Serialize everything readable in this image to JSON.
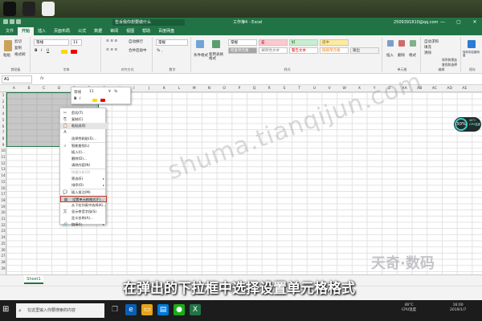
{
  "window": {
    "title": "工作簿4 - Excel",
    "search_placeholder": "告诉我你想要做什么",
    "user": "2509391810@qq.com",
    "controls": [
      "—",
      "▢",
      "✕"
    ]
  },
  "tabs": [
    "文件",
    "开始",
    "插入",
    "页面布局",
    "公式",
    "数据",
    "审阅",
    "视图",
    "帮助",
    "百度网盘"
  ],
  "active_tab": "开始",
  "ribbon": {
    "clipboard": {
      "label": "剪贴板",
      "cut": "剪切",
      "copy": "复制",
      "format_painter": "格式刷",
      "paste": "粘贴"
    },
    "font": {
      "label": "字体",
      "name": "等线",
      "size": "11"
    },
    "alignment": {
      "label": "对齐方式",
      "wrap": "自动换行",
      "merge": "合并后居中"
    },
    "number": {
      "label": "数字",
      "format": "常规"
    },
    "styles": {
      "label": "样式",
      "cond_format": "条件格式",
      "table_format": "套用表格格式",
      "items": [
        "常规",
        "差",
        "好",
        "适中",
        "检查单元格",
        "解释性文本",
        "警告文本",
        "链接单元格",
        "输出"
      ]
    },
    "cells": {
      "label": "单元格",
      "insert": "插入",
      "delete": "删除",
      "format": "格式"
    },
    "editing": {
      "label": "编辑",
      "autosum": "自动求和",
      "fill": "填充",
      "clear": "清除",
      "sort": "排序和筛选",
      "find": "查找和选择"
    },
    "save": {
      "label": "保存",
      "button": "保存到百度网盘"
    }
  },
  "formula_bar": {
    "name_box": "A1",
    "fx": "fx"
  },
  "columns": [
    "A",
    "B",
    "C",
    "D",
    "E",
    "F",
    "G",
    "H",
    "I",
    "J",
    "K",
    "L",
    "M",
    "N",
    "O",
    "P",
    "Q",
    "R",
    "S",
    "T",
    "U",
    "V",
    "W",
    "X",
    "Y",
    "Z",
    "AA",
    "AB",
    "AC",
    "AD",
    "AE"
  ],
  "rows": [
    "1",
    "2",
    "3",
    "4",
    "5",
    "6",
    "7",
    "8",
    "9",
    "10",
    "11",
    "12",
    "13",
    "14",
    "15",
    "16",
    "17",
    "18",
    "19",
    "20",
    "21",
    "22",
    "23",
    "24",
    "25",
    "26",
    "27",
    "28",
    "29"
  ],
  "mini_toolbar": {
    "font": "等线",
    "size": "11",
    "currency": "¥",
    "percent": "%"
  },
  "context_menu": [
    {
      "label": "剪切(T)",
      "icon": "✂",
      "state": "normal"
    },
    {
      "label": "复制(C)",
      "icon": "⎘",
      "state": "normal"
    },
    {
      "label": "粘贴选项:",
      "icon": "📋",
      "state": "hover"
    },
    {
      "label": "",
      "icon": "A",
      "state": "normal"
    },
    {
      "label": "选择性粘贴(S)...",
      "icon": "",
      "state": "normal"
    },
    {
      "label": "智能查找(L)",
      "icon": "⌕",
      "state": "normal"
    },
    {
      "label": "插入(I)...",
      "icon": "",
      "state": "normal"
    },
    {
      "label": "删除(D)...",
      "icon": "",
      "state": "normal"
    },
    {
      "label": "清除内容(N)",
      "icon": "",
      "state": "normal"
    },
    {
      "label": "快速分析(Q)",
      "icon": "",
      "state": "disabled"
    },
    {
      "label": "筛选(E)",
      "icon": "",
      "state": "normal",
      "submenu": true
    },
    {
      "label": "排序(O)",
      "icon": "",
      "state": "normal",
      "submenu": true
    },
    {
      "label": "插入批注(M)",
      "icon": "💬",
      "state": "normal"
    },
    {
      "label": "设置单元格格式(F)...",
      "icon": "▦",
      "state": "highlight"
    },
    {
      "label": "从下拉列表中选择(K)...",
      "icon": "",
      "state": "normal"
    },
    {
      "label": "显示拼音字段(S)",
      "icon": "文",
      "state": "normal"
    },
    {
      "label": "定义名称(A)...",
      "icon": "",
      "state": "normal"
    },
    {
      "label": "链接(I)",
      "icon": "🔗",
      "state": "normal",
      "submenu": true
    }
  ],
  "sheet_tab": "Sheet1",
  "watermark": "shuma.tianqijun.com",
  "brand": "天奇·数码",
  "caption": "在弹出的下拉框中选择设置单元格格式",
  "cpu_gauge": {
    "percent": "30%",
    "temp": "46°C",
    "label": "CPU温度"
  },
  "taskbar": {
    "search_placeholder": "在这里输入你要搜索的内容",
    "tray_temp": "46°C",
    "tray_temp_label": "CPU温度",
    "time": "16:00",
    "date": "2019/1/7"
  },
  "colors": {
    "excel_green": "#217346",
    "highlight_red": "#c0392b"
  }
}
